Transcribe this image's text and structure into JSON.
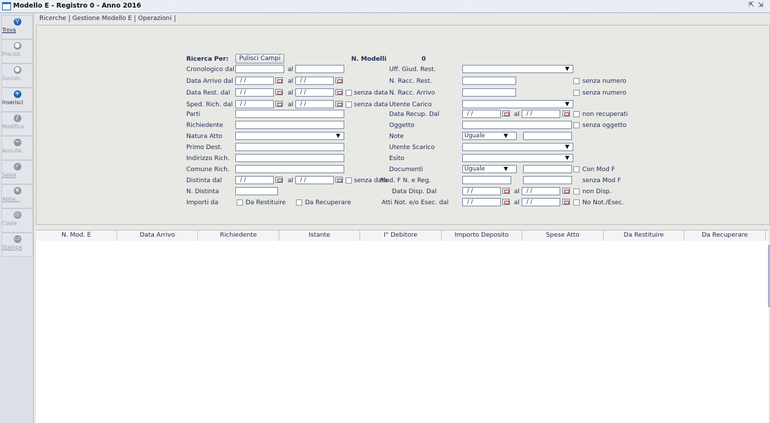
{
  "window": {
    "title": "Modello E - Registro 0 - Anno 2016",
    "right_icons": [
      "restore-icon",
      "detach-icon"
    ]
  },
  "toolbar": [
    {
      "label": "Trova",
      "icon": "search-icon",
      "enabled": true
    },
    {
      "label": "Preced.",
      "icon": "prev-icon",
      "enabled": false
    },
    {
      "label": "Succes.",
      "icon": "next-icon",
      "enabled": false
    },
    {
      "label": "Inserisci",
      "icon": "plus-icon",
      "enabled": true
    },
    {
      "label": "Modifica",
      "icon": "pencil-icon",
      "enabled": false
    },
    {
      "label": "Annulla",
      "icon": "minus-icon",
      "enabled": false
    },
    {
      "label": "Salva",
      "icon": "check-icon",
      "enabled": false
    },
    {
      "label": "Abba...",
      "icon": "cross-icon",
      "enabled": false
    },
    {
      "label": "Copia",
      "icon": "copy-icon",
      "enabled": false
    },
    {
      "label": "Stampa",
      "icon": "print-icon",
      "enabled": false
    }
  ],
  "tabs": [
    "Ricerche",
    "Gestione Modello E",
    "Operazioni"
  ],
  "form": {
    "ricerca_per": "Ricerca Per:",
    "pulisci": "Pulisci Campi",
    "n_modelli_label": "N. Modelli",
    "n_modelli_value": "0",
    "al": "al",
    "date_placeholder": " /  / ",
    "senza_data": "senza data",
    "left_labels": [
      "Cronologico dal",
      "Data Arrivo dal",
      "Data Rest. dal",
      "Sped. Rich. dal",
      "Parti",
      "Richiedente",
      "Natura Atto",
      "Primo Dest.",
      "Indirizzo Rich.",
      "Comune Rich.",
      "Distinta dal",
      "N. Distinta",
      "Importi da"
    ],
    "da_restituire": "Da Restituire",
    "da_recuperare": "Da Recuperare",
    "right_labels": [
      "Uff. Giud. Rest.",
      "N. Racc. Rest.",
      "N. Racc. Arrivo",
      "Utente Carico",
      "Data Recup. Dal",
      "Oggetto",
      "Note",
      "Utente Scarico",
      "Esito",
      "Documenti",
      "Mod. F N. e Reg.",
      "Data Disp. Dal",
      "Atti Not. e/o Esec. dal"
    ],
    "uguale": "Uguale",
    "right_checks": [
      "senza numero",
      "senza numero",
      "non recuperati",
      "senza oggetto",
      "Con Mod F",
      "senza Mod F",
      "non Disp.",
      "No Not./Esec."
    ]
  },
  "table": {
    "columns": [
      "N. Mod. E",
      "Data Arrivo",
      "Richiedente",
      "Istante",
      "I° Debitore",
      "Importo Deposito",
      "Spese Atto",
      "Da Restituire",
      "Da Recuperare"
    ]
  }
}
